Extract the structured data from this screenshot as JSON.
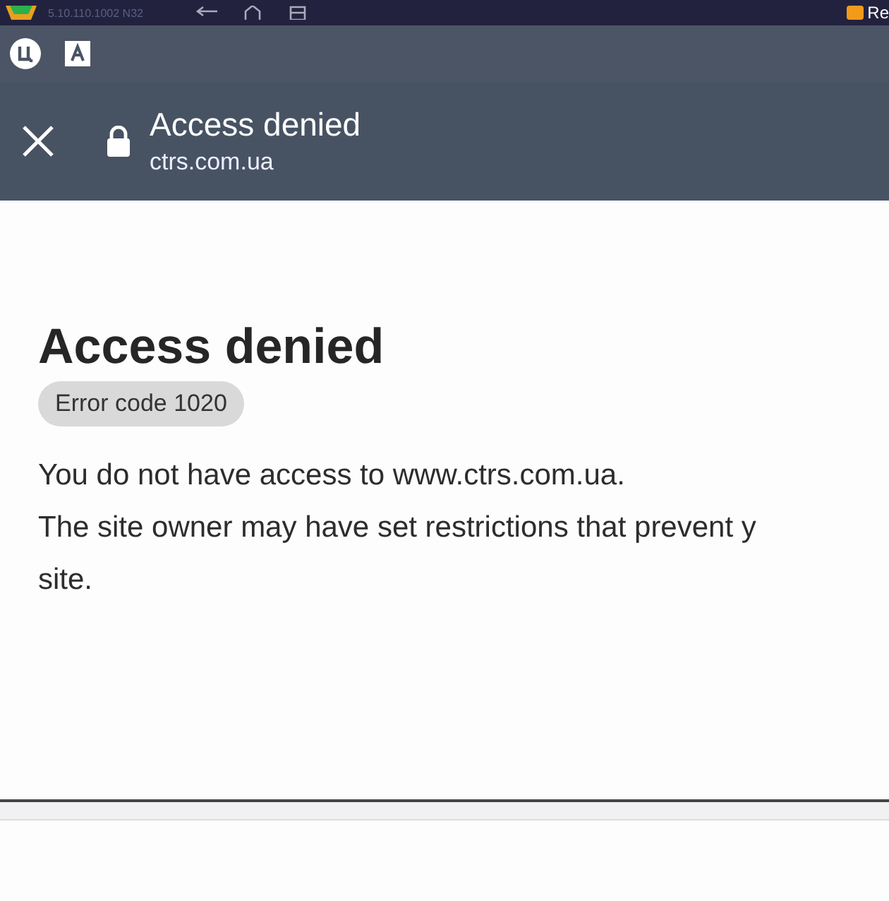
{
  "emulator_bar": {
    "version": "5.10.110.1002 N32",
    "notification": "Re"
  },
  "status_bar": {
    "icons": [
      {
        "kind": "circle-app"
      },
      {
        "kind": "font-app"
      }
    ]
  },
  "header": {
    "title": "Access denied",
    "url": "ctrs.com.ua",
    "secure": true
  },
  "page": {
    "heading": "Access denied",
    "error_code": "Error code 1020",
    "lines": [
      "You do not have access to www.ctrs.com.ua.",
      "The site owner may have set restrictions that prevent y",
      "site."
    ]
  }
}
